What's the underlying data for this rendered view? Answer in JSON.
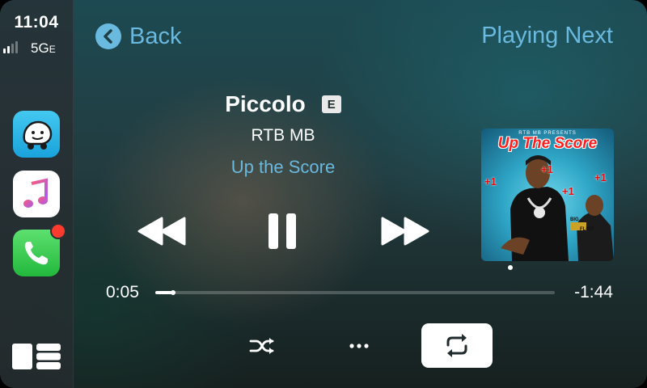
{
  "status": {
    "time": "11:04",
    "network": "5G",
    "network_suffix": "E",
    "signal_bars": 2,
    "signal_total": 4
  },
  "sidebar": {
    "apps": [
      {
        "name": "Waze",
        "icon": "waze-icon"
      },
      {
        "name": "Music",
        "icon": "music-note-icon"
      },
      {
        "name": "Phone",
        "icon": "phone-icon",
        "badge": true
      }
    ],
    "dashboard_icon": "dashboard-icon"
  },
  "header": {
    "back_label": "Back",
    "playing_next_label": "Playing Next"
  },
  "track": {
    "title": "Piccolo",
    "explicit_label": "E",
    "artist": "RTB MB",
    "album": "Up the Score"
  },
  "artwork": {
    "header_text": "RTB MB PRESENTS",
    "title_text": "Up The Score",
    "plus_marks": [
      "+1",
      "+1",
      "+1",
      "+1"
    ],
    "badge_left": "BIG",
    "badge_right": "FLIRT"
  },
  "progress": {
    "elapsed": "0:05",
    "remaining": "-1:44",
    "fraction": 0.045
  },
  "controls": {
    "rewind": "rewind-icon",
    "pause": "pause-icon",
    "forward": "fast-forward-icon",
    "shuffle": "shuffle-icon",
    "more": "more-icon",
    "repeat": "repeat-icon",
    "repeat_active": true
  },
  "colors": {
    "accent": "#6ab9df",
    "badge": "#ff3b30"
  }
}
